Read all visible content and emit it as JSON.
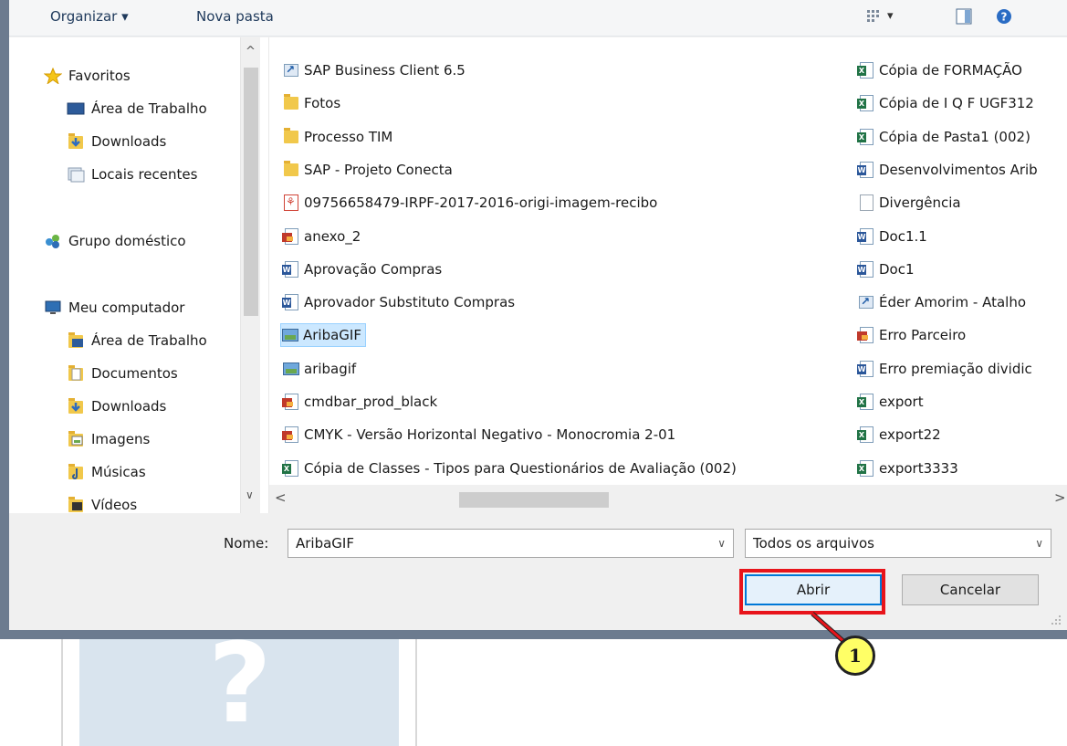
{
  "toolbar": {
    "organize_label": "Organizar ▾",
    "new_folder_label": "Nova pasta",
    "views_icon": "view-options-icon",
    "views_caret": "▾",
    "pane_icon": "preview-pane-icon",
    "help_icon": "help-icon"
  },
  "nav": {
    "favorites": "Favoritos",
    "fav_desktop": "Área de Trabalho",
    "fav_downloads": "Downloads",
    "fav_recent": "Locais recentes",
    "homegroup": "Grupo doméstico",
    "computer": "Meu computador",
    "pc_desktop": "Área de Trabalho",
    "pc_documents": "Documentos",
    "pc_downloads": "Downloads",
    "pc_images": "Imagens",
    "pc_music": "Músicas",
    "pc_videos": "Vídeos"
  },
  "files": {
    "col1": [
      {
        "name": "SAP Business Client 6.5",
        "icon": "shortcut-icon"
      },
      {
        "name": "Fotos",
        "icon": "folder-icon"
      },
      {
        "name": "Processo TIM",
        "icon": "folder-icon"
      },
      {
        "name": "SAP - Projeto Conecta",
        "icon": "folder-icon"
      },
      {
        "name": "09756658479-IRPF-2017-2016-origi-imagem-recibo",
        "icon": "pdf-icon"
      },
      {
        "name": "anexo_2",
        "icon": "paint-image-icon"
      },
      {
        "name": "Aprovação Compras",
        "icon": "word-doc-icon"
      },
      {
        "name": "Aprovador Substituto Compras",
        "icon": "word-doc-icon"
      },
      {
        "name": "AribaGIF",
        "icon": "image-icon"
      },
      {
        "name": "aribagif",
        "icon": "image-icon"
      },
      {
        "name": "cmdbar_prod_black",
        "icon": "paint-image-icon"
      },
      {
        "name": "CMYK - Versão Horizontal Negativo - Monocromia 2-01",
        "icon": "paint-image-icon"
      },
      {
        "name": "Cópia de Classes - Tipos para Questionários de Avaliação (002)",
        "icon": "excel-doc-icon"
      }
    ],
    "col2": [
      {
        "name": "Cópia de FORMAÇÃO",
        "icon": "excel-doc-icon"
      },
      {
        "name": "Cópia de I Q F UGF312",
        "icon": "excel-doc-icon"
      },
      {
        "name": "Cópia de Pasta1 (002)",
        "icon": "excel-doc-icon"
      },
      {
        "name": "Desenvolvimentos Arib",
        "icon": "word-doc-icon"
      },
      {
        "name": "Divergência",
        "icon": "text-doc-icon"
      },
      {
        "name": "Doc1.1",
        "icon": "word-doc-icon"
      },
      {
        "name": "Doc1",
        "icon": "word-doc-icon"
      },
      {
        "name": "Éder Amorim - Atalho",
        "icon": "shortcut-icon"
      },
      {
        "name": "Erro Parceiro",
        "icon": "paint-image-icon"
      },
      {
        "name": "Erro premiação dividic",
        "icon": "word-doc-icon"
      },
      {
        "name": "export",
        "icon": "excel-doc-icon"
      },
      {
        "name": "export22",
        "icon": "excel-doc-icon"
      },
      {
        "name": "export3333",
        "icon": "excel-doc-icon"
      }
    ],
    "selected": "AribaGIF"
  },
  "footer": {
    "name_label": "Nome:",
    "name_value": "AribaGIF",
    "filter_value": "Todos os arquivos",
    "open_label": "Abrir",
    "cancel_label": "Cancelar",
    "caret": "∨"
  },
  "scroll": {
    "up": "^",
    "down": "∨",
    "left": "<",
    "right": ">"
  },
  "callout": {
    "number": "1"
  },
  "background": {
    "placeholder_glyph": "?"
  }
}
